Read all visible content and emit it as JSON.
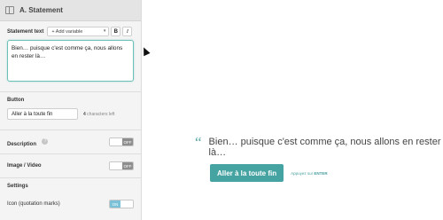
{
  "sidebar": {
    "title": "A. Statement",
    "statement": {
      "label": "Statement text",
      "variable_select": "+ Add variable",
      "bold": "B",
      "italic": "I",
      "text": "Bien… puisque c'est comme ça, nous allons en rester là…"
    },
    "button": {
      "label": "Button",
      "value": "Aller à la toute fin",
      "chars_left_count": "4",
      "chars_left_text": "characters left"
    },
    "description": {
      "label": "Description",
      "toggle": "OFF"
    },
    "image_video": {
      "label": "Image / Video",
      "toggle": "OFF"
    },
    "settings": {
      "label": "Settings",
      "icon_label": "Icon (quotation marks)",
      "icon_toggle": "ON"
    }
  },
  "preview": {
    "quote_mark": "“",
    "statement": "Bien… puisque c'est comme ça, nous allons en rester là…",
    "button_label": "Aller à la toute fin",
    "press_hint": "Appuyez sur",
    "press_key": "ENTER"
  },
  "colors": {
    "accent": "#45a3a2",
    "toggle_on": "#7bc2d9",
    "toggle_off": "#8e8e8e"
  },
  "icons": [
    "collapse-panel-icon",
    "chevron-down-icon",
    "help-icon",
    "quote-icon",
    "cursor-icon"
  ]
}
